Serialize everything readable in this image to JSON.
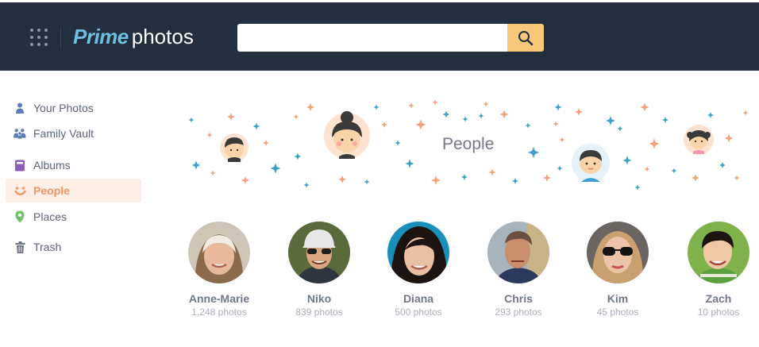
{
  "header": {
    "logo_prime": "Prime",
    "logo_photos": "photos",
    "search_placeholder": "",
    "search_icon": "search-icon",
    "apps_icon": "grid-apps-icon"
  },
  "sidebar": {
    "items": [
      {
        "label": "Your Photos",
        "icon": "person-icon"
      },
      {
        "label": "Family Vault",
        "icon": "family-icon"
      },
      {
        "label": "Albums",
        "icon": "album-icon"
      },
      {
        "label": "People",
        "icon": "smiley-icon",
        "active": true
      },
      {
        "label": "Places",
        "icon": "location-pin-icon"
      },
      {
        "label": "Trash",
        "icon": "trash-icon"
      }
    ]
  },
  "banner": {
    "title": "People"
  },
  "people": [
    {
      "name": "Anne-Marie",
      "count": "1,248 photos"
    },
    {
      "name": "Niko",
      "count": "839 photos"
    },
    {
      "name": "Diana",
      "count": "500 photos"
    },
    {
      "name": "Chris",
      "count": "293 photos"
    },
    {
      "name": "Kim",
      "count": "45 photos"
    },
    {
      "name": "Zach",
      "count": "10 photos"
    }
  ],
  "colors": {
    "header_bg": "#232f3e",
    "accent": "#f0946a",
    "search_button": "#f7c87a",
    "logo_prime": "#6ebfe0",
    "sparkle_orange": "#f4a07a",
    "sparkle_blue": "#3a9fc4"
  }
}
